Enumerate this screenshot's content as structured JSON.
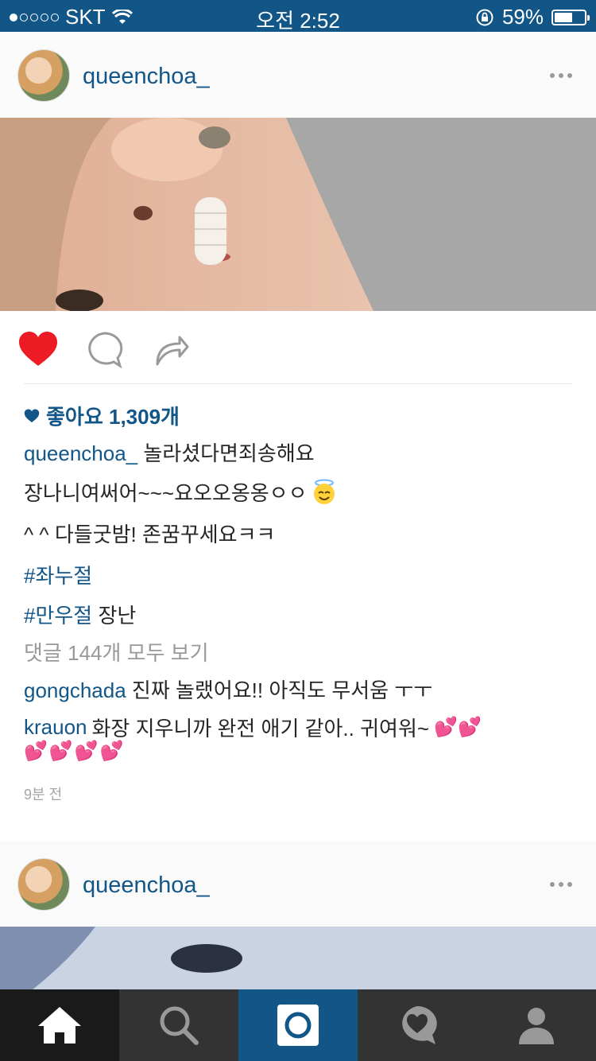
{
  "status_bar": {
    "carrier": "SKT",
    "time": "오전 2:52",
    "battery_percent": "59%",
    "signal_strength_dots": 1,
    "battery_level": 0.59
  },
  "posts": [
    {
      "username": "queenchoa_",
      "likes_text": "좋아요 1,309개",
      "caption": {
        "username": "queenchoa_",
        "text1": "놀라셨다면죄송해요",
        "text2": "장나니여써어~~~요오오옹옹ㅇㅇ",
        "text3": "^ ^  다들굿밤! 존꿈꾸세요ㅋㅋ",
        "hashtag1": "#좌누절",
        "hashtag2": "#만우절",
        "text4": "장난"
      },
      "view_all_comments": "댓글 144개 모두 보기",
      "comments": [
        {
          "username": "gongchada",
          "text": "진짜 놀랬어요!! 아직도 무서움 ㅜㅜ"
        },
        {
          "username": "krauon",
          "text": "화장 지우니까 완전 애기 같아.. 귀여워~"
        }
      ],
      "time_ago": "9분 전"
    },
    {
      "username": "queenchoa_"
    }
  ],
  "icons": {
    "heart": "heart-icon",
    "comment": "comment-icon",
    "share": "share-icon"
  },
  "colors": {
    "status_bar": "#125688",
    "link": "#125688",
    "like_red": "#ed1c24",
    "tab_active": "#125688"
  }
}
